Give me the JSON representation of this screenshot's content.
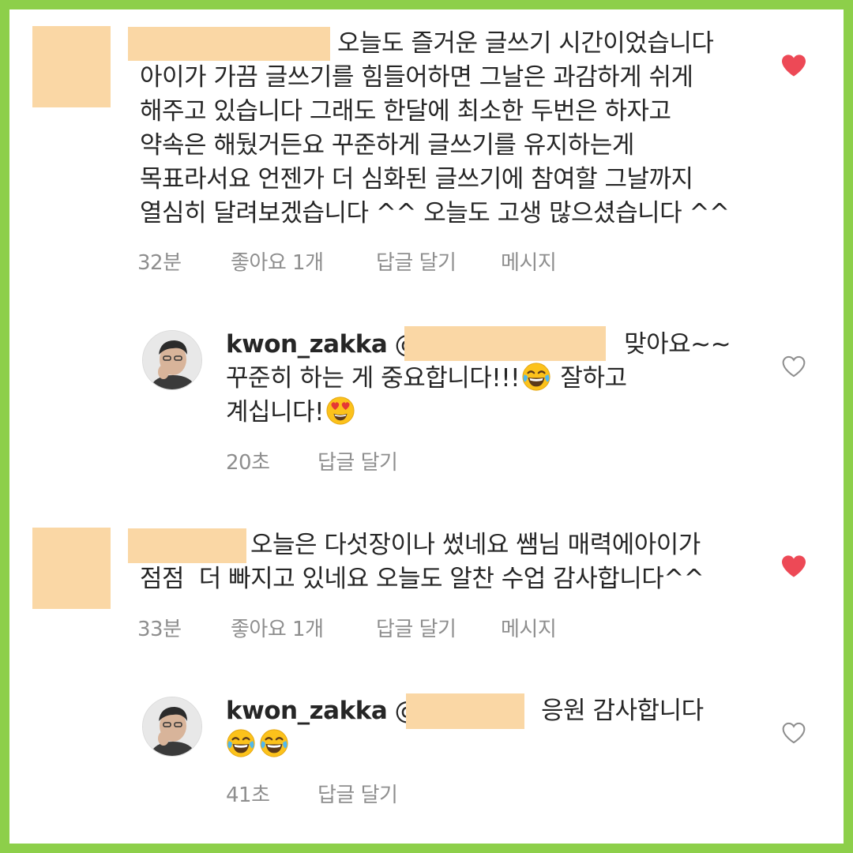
{
  "comments": [
    {
      "liked": true,
      "text_lines": [
        "오늘도 즐거운 글쓰기 시간이었습니다",
        "아이가 가끔 글쓰기를 힘들어하면 그날은 과감하게 쉬게",
        "해주고 있습니다 그래도 한달에 최소한 두번은 하자고",
        "약속은 해뒀거든요 꾸준하게 글쓰기를 유지하는게",
        "목표라서요 언젠가 더 심화된 글쓰기에 참여할 그날까지",
        "열심히 달려보겠습니다 ^^ 오늘도 고생 많으셨습니다 ^^"
      ],
      "time": "32분",
      "likes": "좋아요 1개",
      "reply_label": "답글 달기",
      "message_label": "메시지",
      "reply": {
        "username": "kwon_zakka",
        "mention_prefix": "@",
        "line1_suffix": "맞아요~~",
        "line2": "꾸준히 하는 게 중요합니다!!!",
        "line2_tail": " 잘하고",
        "line3": "계십니다!",
        "time": "20초",
        "reply_label": "답글 달기",
        "liked": false
      }
    },
    {
      "liked": true,
      "text_lines": [
        "오늘은 다섯장이나 썼네요 쌤님 매력에아이가",
        "점점  더 빠지고 있네요 오늘도 알찬 수업 감사합니다^^"
      ],
      "time": "33분",
      "likes": "좋아요 1개",
      "reply_label": "답글 달기",
      "message_label": "메시지",
      "reply": {
        "username": "kwon_zakka",
        "mention_prefix": "@",
        "line1_suffix": "응원 감사합니다",
        "time": "41초",
        "reply_label": "답글 달기",
        "liked": false
      }
    }
  ],
  "colors": {
    "border": "#8dcf4a",
    "redaction": "#fad7a5",
    "heart_liked": "#ed4956",
    "meta_text": "#8e8e8e"
  },
  "icons": {
    "heart_filled": "heart-filled-icon",
    "heart_outline": "heart-outline-icon",
    "emoji_joy": "face-with-tears-of-joy-icon",
    "emoji_heart_eyes": "smiling-face-with-heart-eyes-icon"
  }
}
